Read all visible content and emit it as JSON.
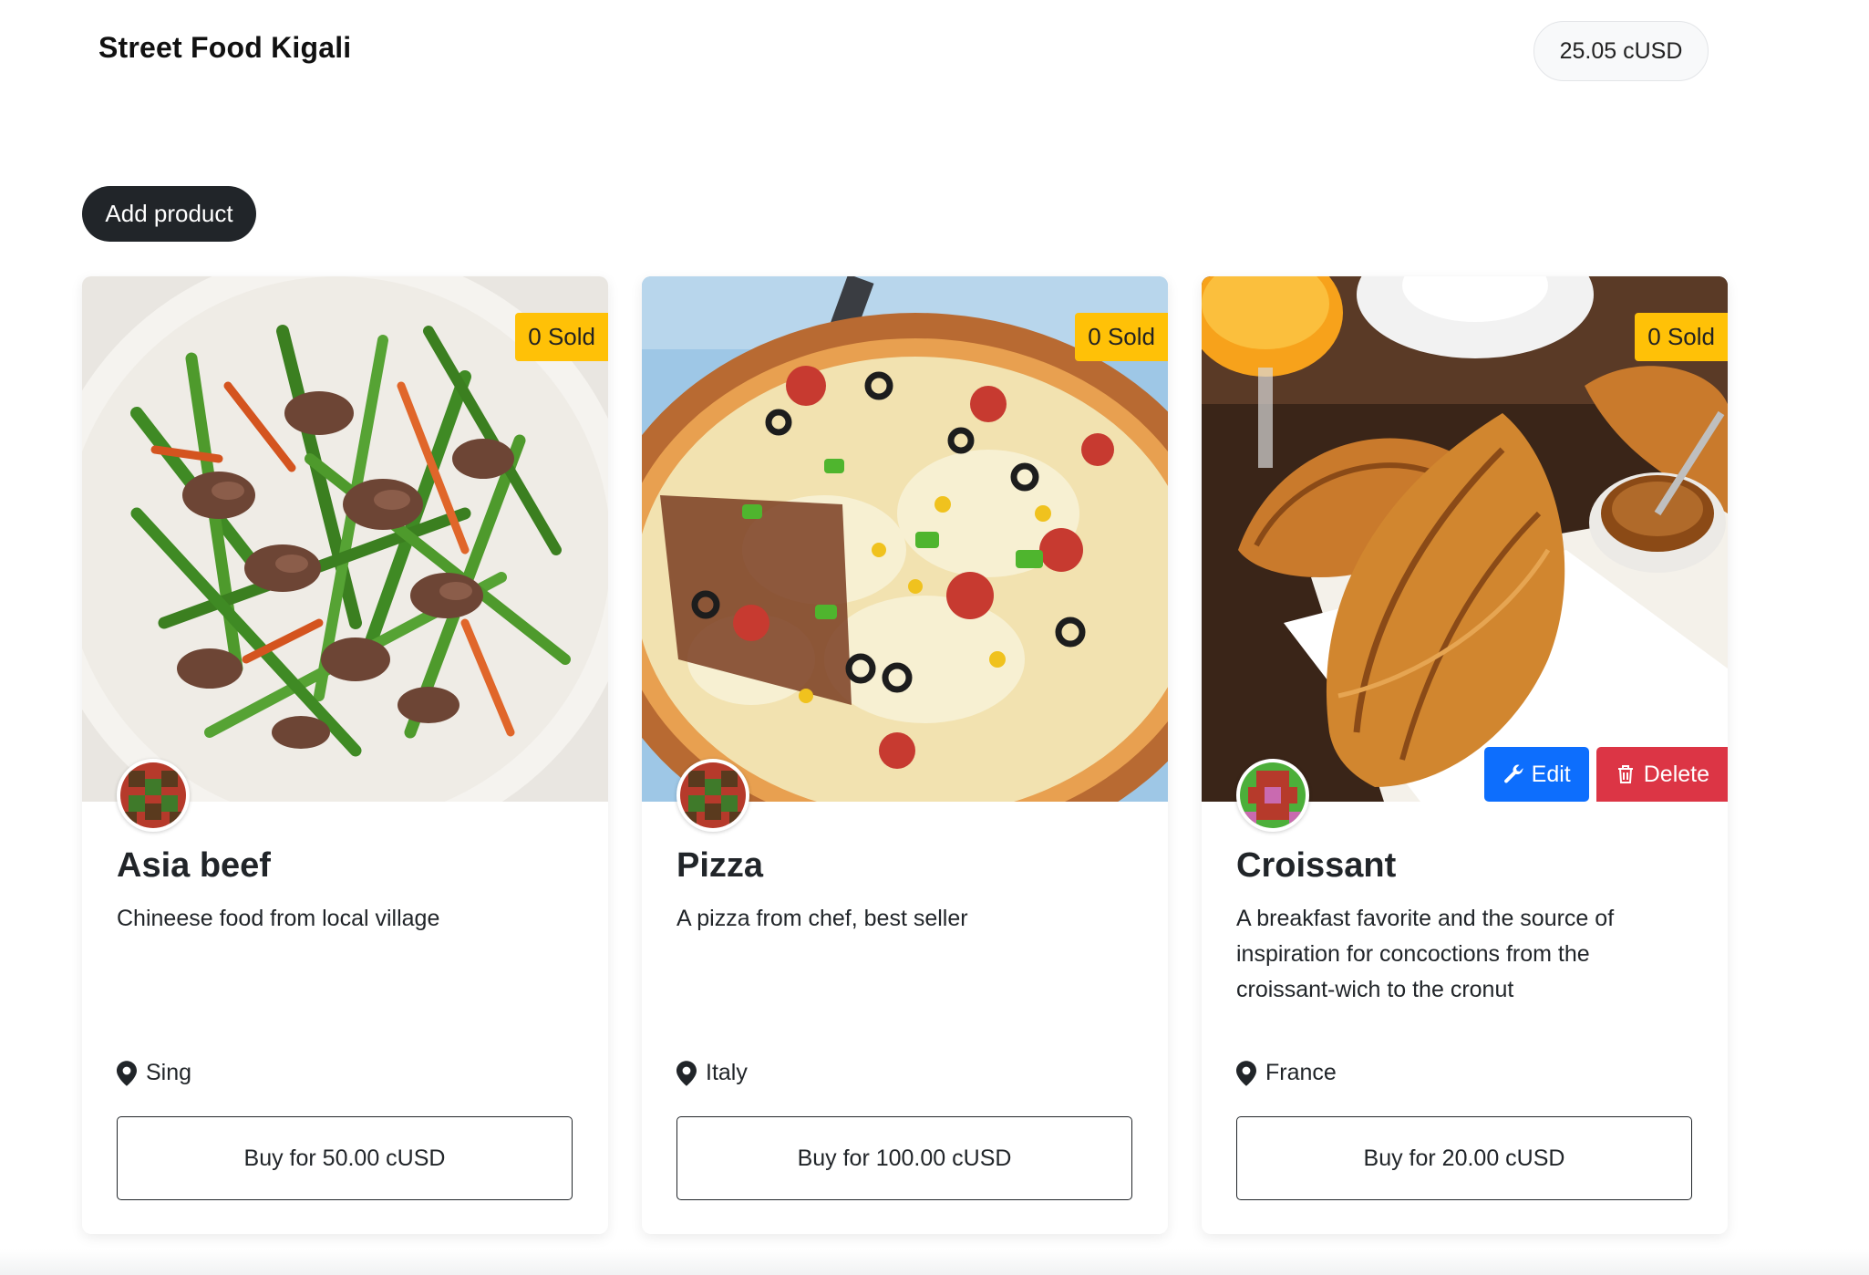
{
  "header": {
    "brand": "Street Food Kigali",
    "balance": "25.05 cUSD"
  },
  "actions": {
    "add_product": "Add product"
  },
  "products": [
    {
      "name": "Asia beef",
      "description": "Chineese food from local village",
      "location": "Sing",
      "sold": "0 Sold",
      "buy_label": "Buy for 50.00 cUSD",
      "image": "beef-stir-fry-photo",
      "avatar": "owner-identicon-1"
    },
    {
      "name": "Pizza",
      "description": "A pizza from chef, best seller",
      "location": "Italy",
      "sold": "0 Sold",
      "buy_label": "Buy for 100.00 cUSD",
      "image": "pizza-photo",
      "avatar": "owner-identicon-1"
    },
    {
      "name": "Croissant",
      "description": "A breakfast favorite and the source of inspiration for concoctions from the croissant-wich to the cronut",
      "location": "France",
      "sold": "0 Sold",
      "buy_label": "Buy for 20.00 cUSD",
      "image": "croissant-photo",
      "avatar": "owner-identicon-2",
      "edit_label": "Edit",
      "delete_label": "Delete"
    }
  ],
  "colors": {
    "primary_dark": "#212529",
    "badge_warning": "#ffc107",
    "edit_blue": "#0d6efd",
    "delete_red": "#dc3545"
  }
}
